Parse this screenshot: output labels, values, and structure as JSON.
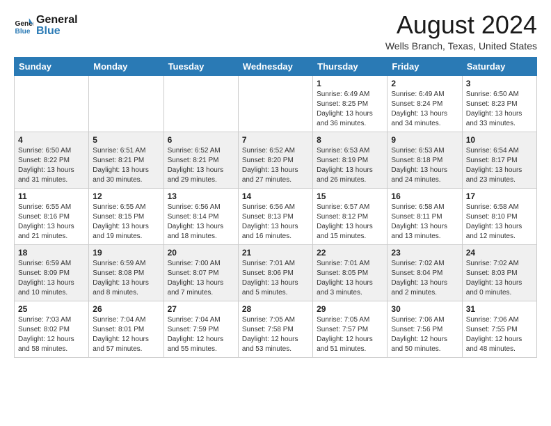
{
  "header": {
    "logo_line1": "General",
    "logo_line2": "Blue",
    "main_title": "August 2024",
    "subtitle": "Wells Branch, Texas, United States"
  },
  "weekdays": [
    "Sunday",
    "Monday",
    "Tuesday",
    "Wednesday",
    "Thursday",
    "Friday",
    "Saturday"
  ],
  "weeks": [
    [
      {
        "day": "",
        "info": ""
      },
      {
        "day": "",
        "info": ""
      },
      {
        "day": "",
        "info": ""
      },
      {
        "day": "",
        "info": ""
      },
      {
        "day": "1",
        "info": "Sunrise: 6:49 AM\nSunset: 8:25 PM\nDaylight: 13 hours\nand 36 minutes."
      },
      {
        "day": "2",
        "info": "Sunrise: 6:49 AM\nSunset: 8:24 PM\nDaylight: 13 hours\nand 34 minutes."
      },
      {
        "day": "3",
        "info": "Sunrise: 6:50 AM\nSunset: 8:23 PM\nDaylight: 13 hours\nand 33 minutes."
      }
    ],
    [
      {
        "day": "4",
        "info": "Sunrise: 6:50 AM\nSunset: 8:22 PM\nDaylight: 13 hours\nand 31 minutes."
      },
      {
        "day": "5",
        "info": "Sunrise: 6:51 AM\nSunset: 8:21 PM\nDaylight: 13 hours\nand 30 minutes."
      },
      {
        "day": "6",
        "info": "Sunrise: 6:52 AM\nSunset: 8:21 PM\nDaylight: 13 hours\nand 29 minutes."
      },
      {
        "day": "7",
        "info": "Sunrise: 6:52 AM\nSunset: 8:20 PM\nDaylight: 13 hours\nand 27 minutes."
      },
      {
        "day": "8",
        "info": "Sunrise: 6:53 AM\nSunset: 8:19 PM\nDaylight: 13 hours\nand 26 minutes."
      },
      {
        "day": "9",
        "info": "Sunrise: 6:53 AM\nSunset: 8:18 PM\nDaylight: 13 hours\nand 24 minutes."
      },
      {
        "day": "10",
        "info": "Sunrise: 6:54 AM\nSunset: 8:17 PM\nDaylight: 13 hours\nand 23 minutes."
      }
    ],
    [
      {
        "day": "11",
        "info": "Sunrise: 6:55 AM\nSunset: 8:16 PM\nDaylight: 13 hours\nand 21 minutes."
      },
      {
        "day": "12",
        "info": "Sunrise: 6:55 AM\nSunset: 8:15 PM\nDaylight: 13 hours\nand 19 minutes."
      },
      {
        "day": "13",
        "info": "Sunrise: 6:56 AM\nSunset: 8:14 PM\nDaylight: 13 hours\nand 18 minutes."
      },
      {
        "day": "14",
        "info": "Sunrise: 6:56 AM\nSunset: 8:13 PM\nDaylight: 13 hours\nand 16 minutes."
      },
      {
        "day": "15",
        "info": "Sunrise: 6:57 AM\nSunset: 8:12 PM\nDaylight: 13 hours\nand 15 minutes."
      },
      {
        "day": "16",
        "info": "Sunrise: 6:58 AM\nSunset: 8:11 PM\nDaylight: 13 hours\nand 13 minutes."
      },
      {
        "day": "17",
        "info": "Sunrise: 6:58 AM\nSunset: 8:10 PM\nDaylight: 13 hours\nand 12 minutes."
      }
    ],
    [
      {
        "day": "18",
        "info": "Sunrise: 6:59 AM\nSunset: 8:09 PM\nDaylight: 13 hours\nand 10 minutes."
      },
      {
        "day": "19",
        "info": "Sunrise: 6:59 AM\nSunset: 8:08 PM\nDaylight: 13 hours\nand 8 minutes."
      },
      {
        "day": "20",
        "info": "Sunrise: 7:00 AM\nSunset: 8:07 PM\nDaylight: 13 hours\nand 7 minutes."
      },
      {
        "day": "21",
        "info": "Sunrise: 7:01 AM\nSunset: 8:06 PM\nDaylight: 13 hours\nand 5 minutes."
      },
      {
        "day": "22",
        "info": "Sunrise: 7:01 AM\nSunset: 8:05 PM\nDaylight: 13 hours\nand 3 minutes."
      },
      {
        "day": "23",
        "info": "Sunrise: 7:02 AM\nSunset: 8:04 PM\nDaylight: 13 hours\nand 2 minutes."
      },
      {
        "day": "24",
        "info": "Sunrise: 7:02 AM\nSunset: 8:03 PM\nDaylight: 13 hours\nand 0 minutes."
      }
    ],
    [
      {
        "day": "25",
        "info": "Sunrise: 7:03 AM\nSunset: 8:02 PM\nDaylight: 12 hours\nand 58 minutes."
      },
      {
        "day": "26",
        "info": "Sunrise: 7:04 AM\nSunset: 8:01 PM\nDaylight: 12 hours\nand 57 minutes."
      },
      {
        "day": "27",
        "info": "Sunrise: 7:04 AM\nSunset: 7:59 PM\nDaylight: 12 hours\nand 55 minutes."
      },
      {
        "day": "28",
        "info": "Sunrise: 7:05 AM\nSunset: 7:58 PM\nDaylight: 12 hours\nand 53 minutes."
      },
      {
        "day": "29",
        "info": "Sunrise: 7:05 AM\nSunset: 7:57 PM\nDaylight: 12 hours\nand 51 minutes."
      },
      {
        "day": "30",
        "info": "Sunrise: 7:06 AM\nSunset: 7:56 PM\nDaylight: 12 hours\nand 50 minutes."
      },
      {
        "day": "31",
        "info": "Sunrise: 7:06 AM\nSunset: 7:55 PM\nDaylight: 12 hours\nand 48 minutes."
      }
    ]
  ]
}
